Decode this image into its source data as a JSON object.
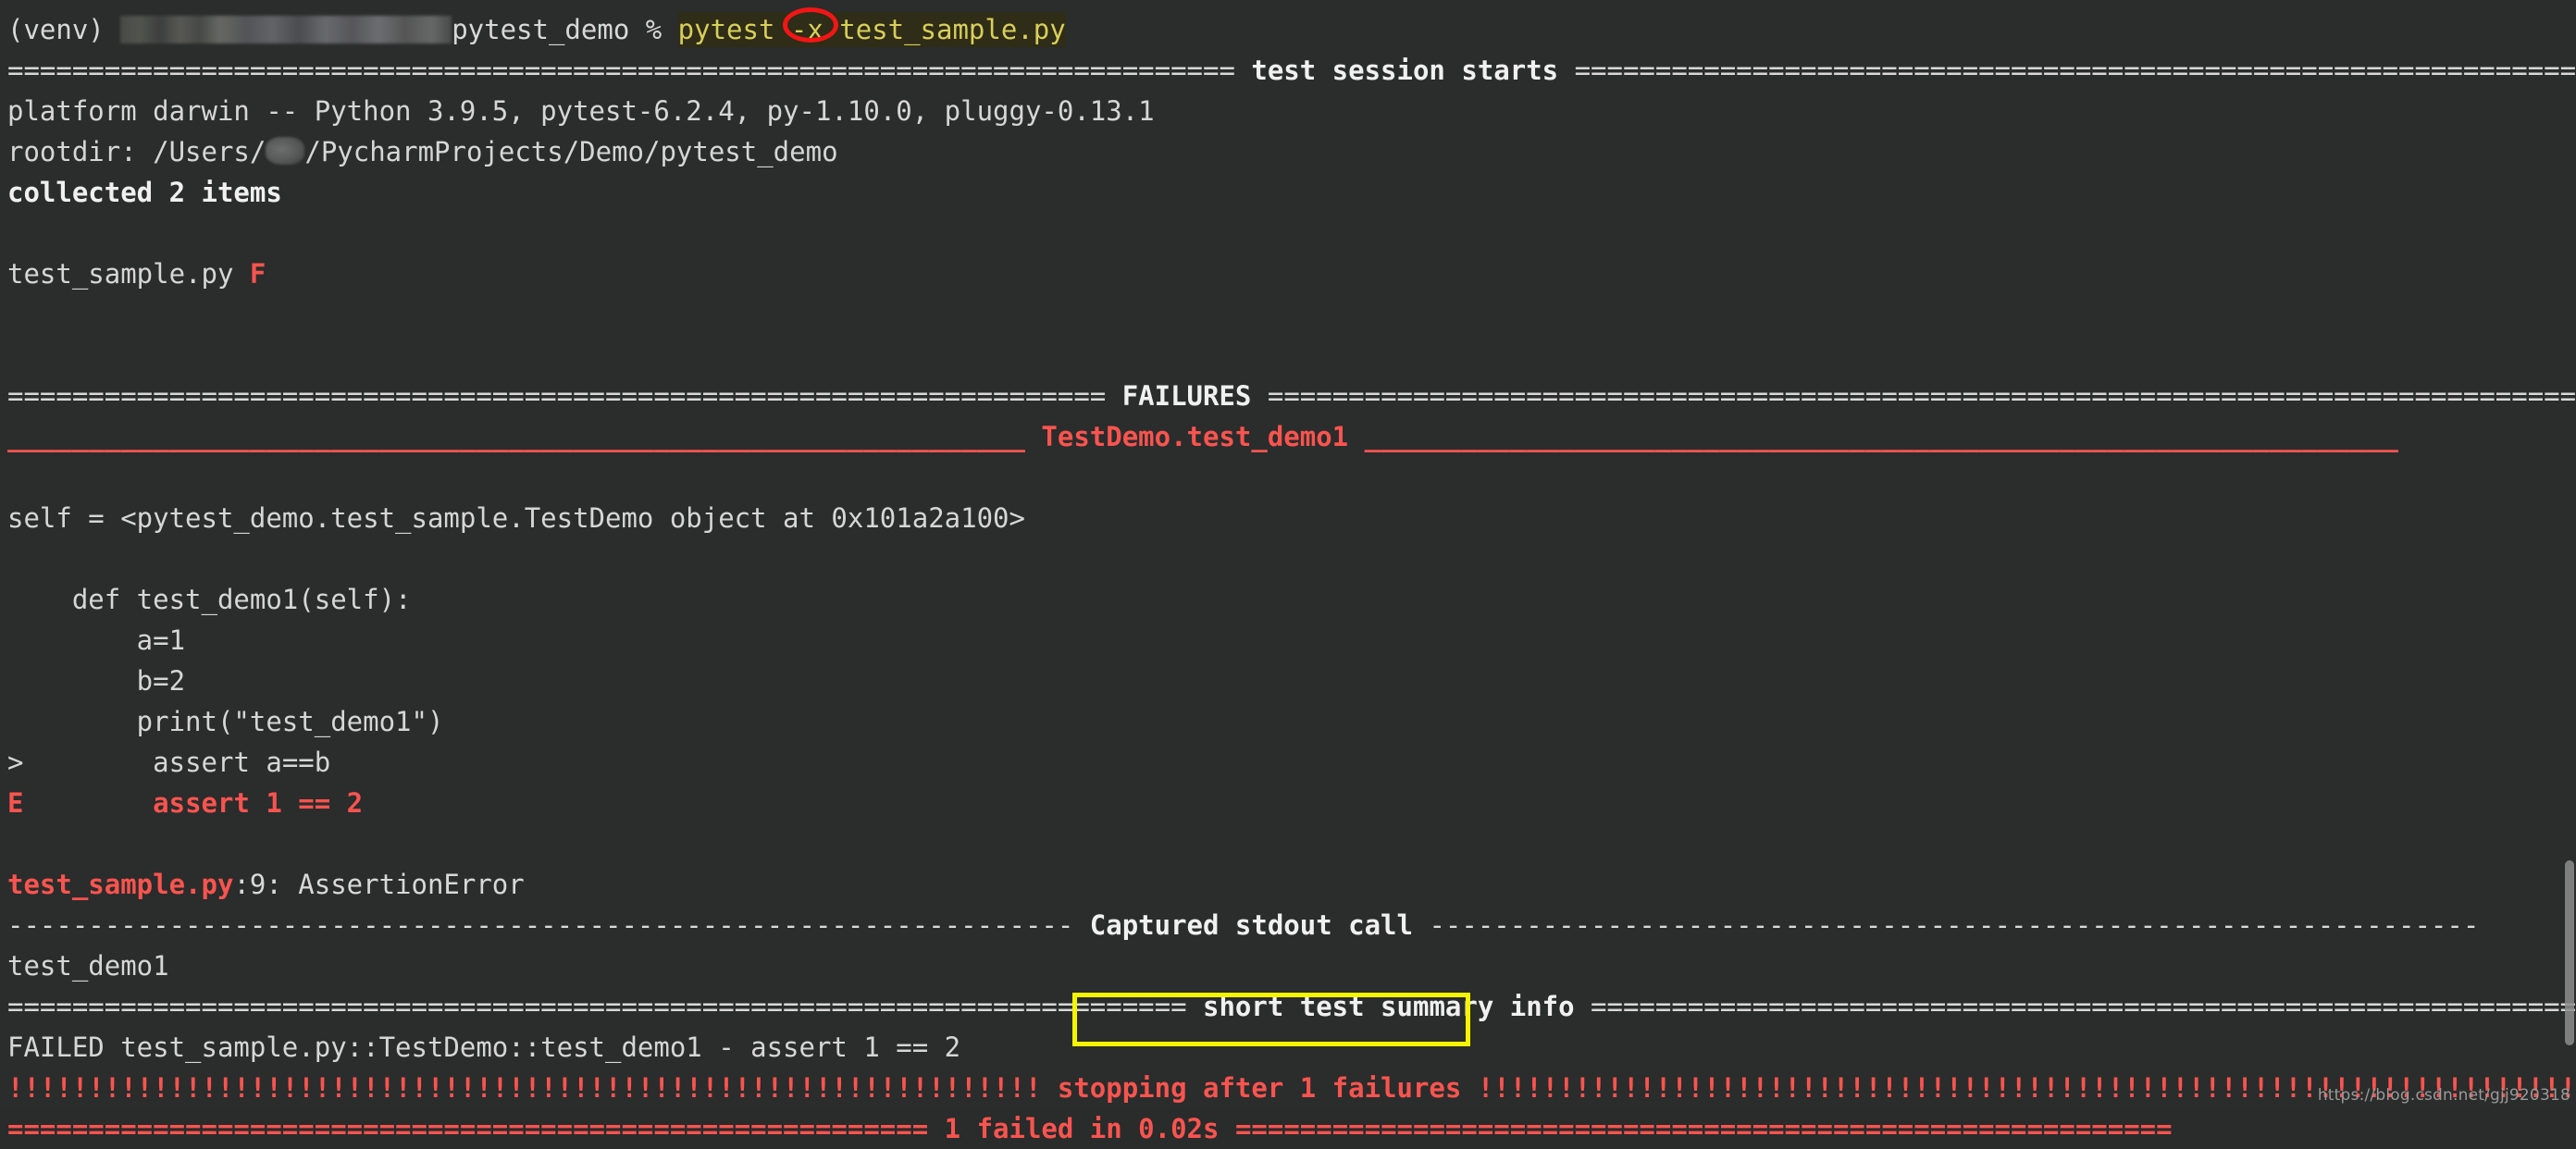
{
  "terminal": {
    "background_color": "#2b2c2c",
    "default_text_color": "#d8d8d8",
    "red_color": "#f8544f",
    "yellow_color": "#d7cf5a",
    "annotation_color_circle": "#f21616",
    "annotation_color_box": "#f5f500"
  },
  "prompt": {
    "venv": "(venv) ",
    "redacted_path": "",
    "dir": "pytest_demo % ",
    "command_name": "pytest ",
    "command_flag": "-x",
    "command_target": " test_sample.py"
  },
  "session": {
    "header_rule_left": "============================================================================",
    "header_title": " test session starts ",
    "header_rule_right": "=================================================================================",
    "platform": "platform darwin -- Python 3.9.5, pytest-6.2.4, py-1.10.0, pluggy-0.13.1",
    "rootdir_prefix": "rootdir: /Users/",
    "rootdir_suffix": "/PycharmProjects/Demo/pytest_demo",
    "collected": "collected 2 items",
    "test_file_line": "test_sample.py ",
    "test_file_result": "F"
  },
  "failures": {
    "rule_left": "====================================================================",
    "title": " FAILURES ",
    "rule_right": "======================================================================================",
    "test_rule_left": "_______________________________________________________________",
    "test_title": " TestDemo.test_demo1 ",
    "test_rule_right": "________________________________________________________________",
    "self_line": "self = <pytest_demo.test_sample.TestDemo object at 0x101a2a100>",
    "code_lines": [
      "    def test_demo1(self):",
      "        a=1",
      "        b=2",
      "        print(\"test_demo1\")"
    ],
    "assert_marker": ">",
    "assert_source": "        assert a==b",
    "error_marker": "E",
    "error_text": "        assert 1 == 2",
    "error_location_file": "test_sample.py",
    "error_location_rest": ":9: AssertionError"
  },
  "captured": {
    "rule_left": "------------------------------------------------------------------",
    "title": " Captured stdout call ",
    "rule_right": "-----------------------------------------------------------------",
    "stdout": "test_demo1"
  },
  "summary": {
    "rule_left": "=========================================================================",
    "title": " short test summary info ",
    "rule_right": "==========================================================================",
    "failed_line": "FAILED test_sample.py::TestDemo::test_demo1 - assert 1 == 2",
    "bang_left": "!!!!!!!!!!!!!!!!!!!!!!!!!!!!!!!!!!!!!!!!!!!!!!!!!!!!!!!!!!!!!!!!",
    "stopping_text": " stopping after 1 failures ",
    "bang_right": "!!!!!!!!!!!!!!!!!!!!!!!!!!!!!!!!!!!!!!!!!!!!!!!!!!!!!!!!!!!!!!!!!!!!!!!!!!",
    "final_rule_left": "=========================================================",
    "final_text": " 1 failed in 0.02s ",
    "final_rule_right": "=========================================================="
  },
  "watermark": "https://blog.csdn.net/gjj920318"
}
